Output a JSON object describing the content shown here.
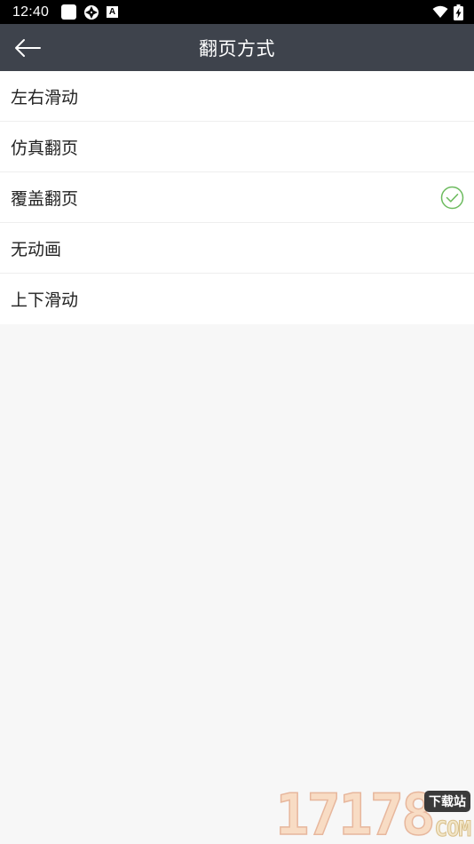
{
  "status_bar": {
    "time": "12:40",
    "left_icons": [
      "square-notification-icon",
      "aperture-icon",
      "a-letter-icon"
    ],
    "a_icon_letter": "A",
    "right_icons": [
      "wifi-icon",
      "battery-charging-icon"
    ]
  },
  "header": {
    "title": "翻页方式",
    "background_color": "#3e434c",
    "back_icon": "arrow-left-icon"
  },
  "options": [
    {
      "label": "左右滑动",
      "selected": false
    },
    {
      "label": "仿真翻页",
      "selected": false
    },
    {
      "label": "覆盖翻页",
      "selected": true
    },
    {
      "label": "无动画",
      "selected": false
    },
    {
      "label": "上下滑动",
      "selected": false
    }
  ],
  "selected_icon": "check-circle-icon",
  "accent_color": "#6dbb5f",
  "watermark": {
    "digits": "17178",
    "badge": "下载站",
    "suffix": "COM"
  }
}
